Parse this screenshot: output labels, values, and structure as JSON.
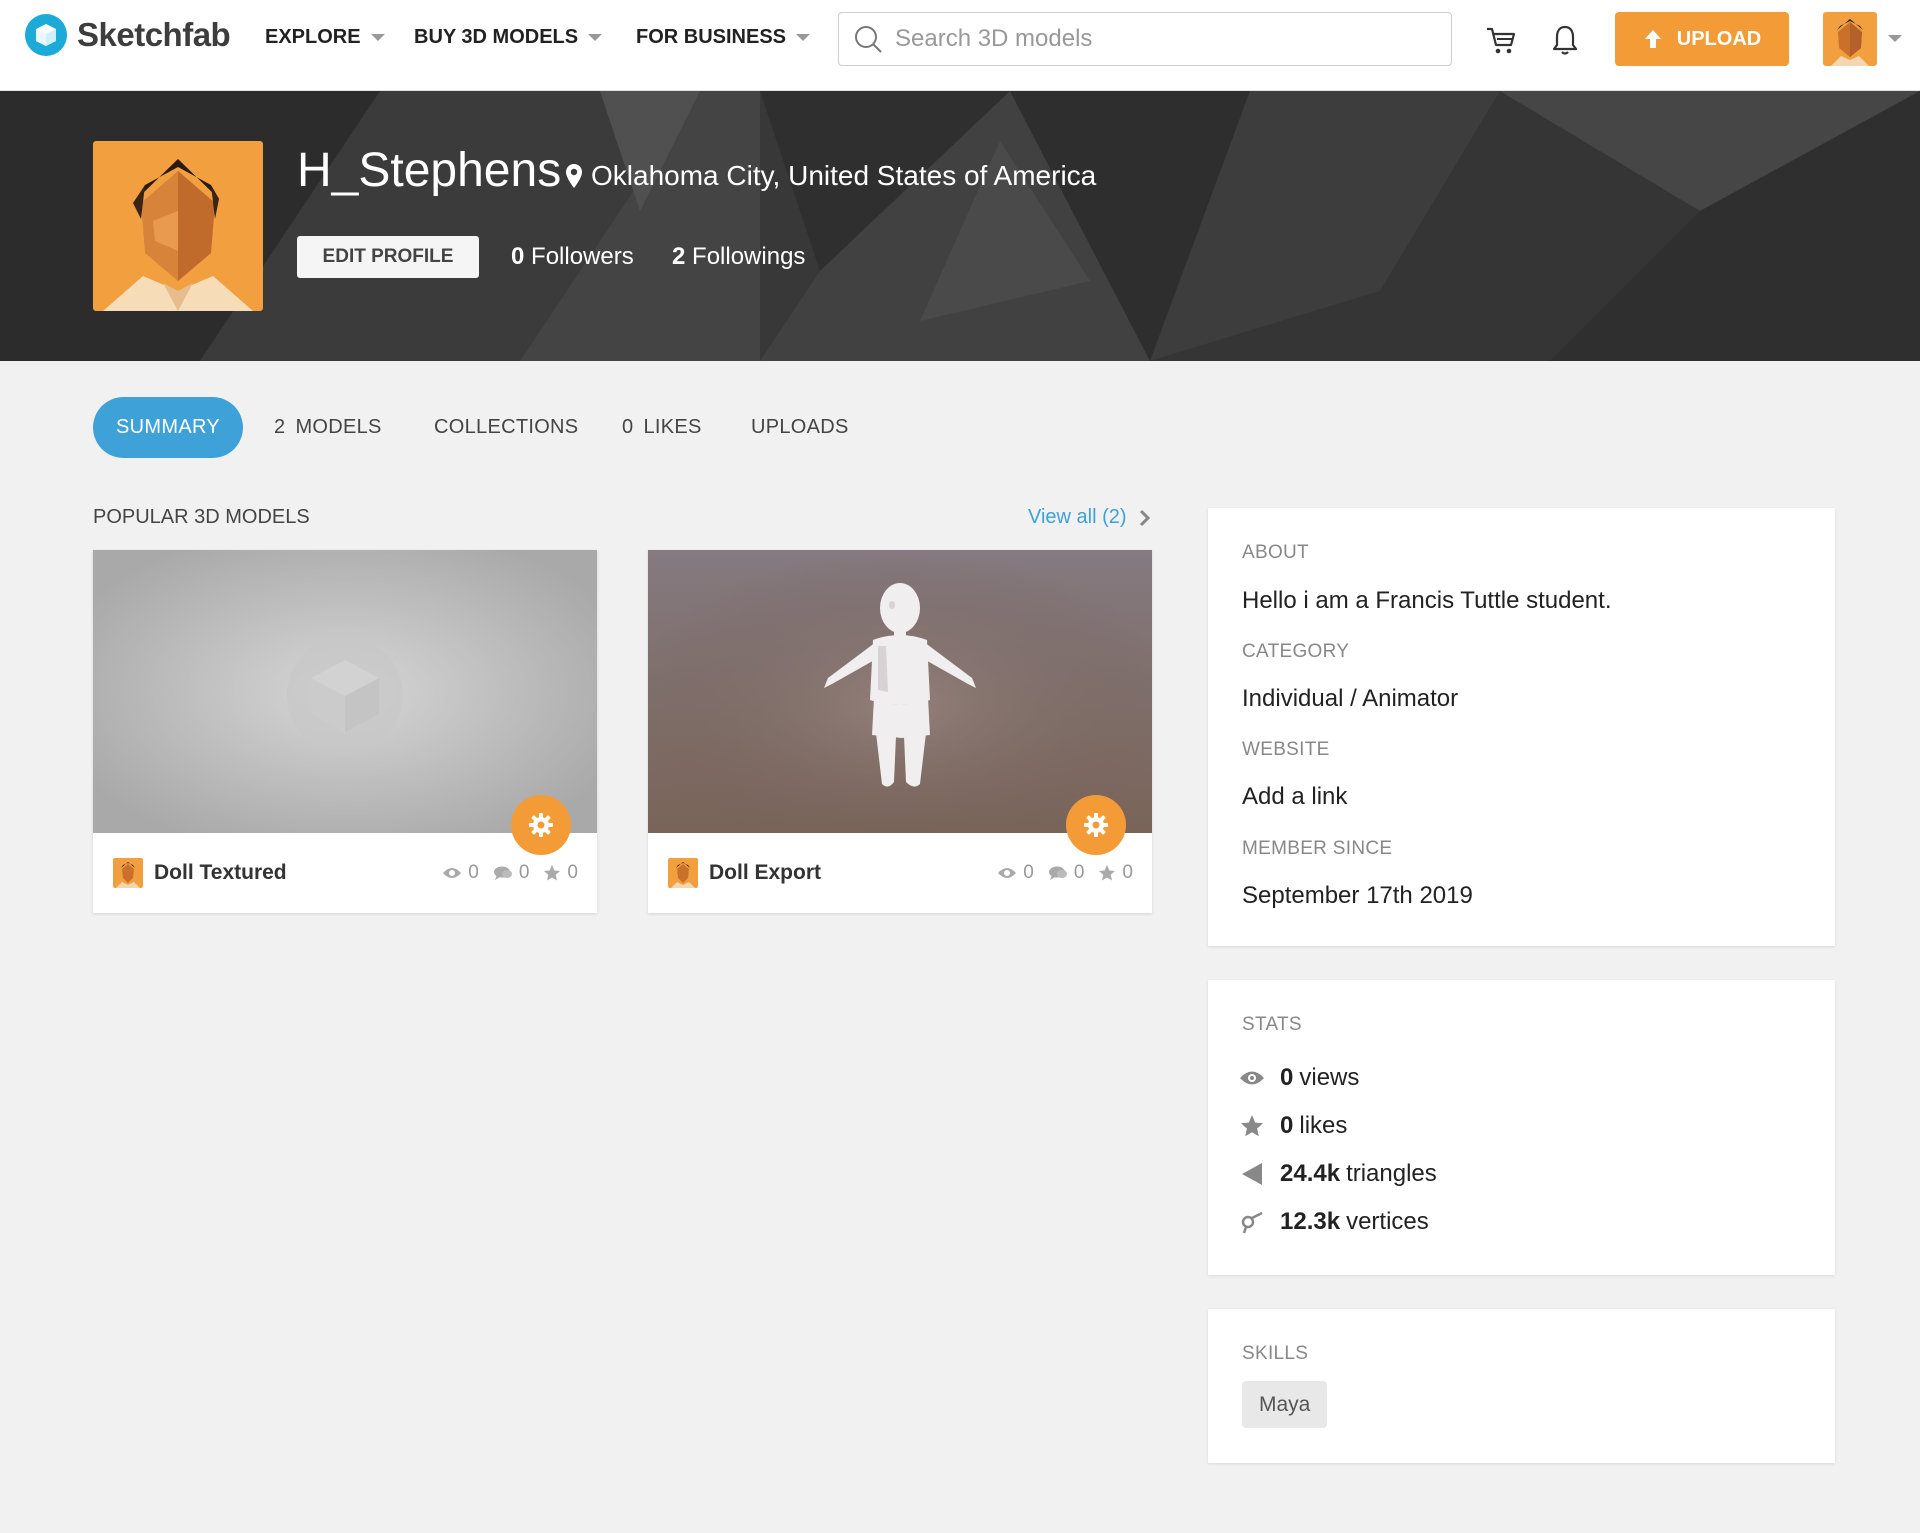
{
  "nav": {
    "logo_text": "Sketchfab",
    "explore": "EXPLORE",
    "buy": "BUY 3D MODELS",
    "business": "FOR BUSINESS",
    "search_placeholder": "Search 3D models",
    "upload": "UPLOAD"
  },
  "profile": {
    "username": "H_Stephens",
    "location": "Oklahoma City, United States of America",
    "edit_profile": "EDIT PROFILE",
    "followers_count": "0",
    "followers_label": "Followers",
    "followings_count": "2",
    "followings_label": "Followings"
  },
  "tabs": {
    "summary": "SUMMARY",
    "models_count": "2",
    "models": "MODELS",
    "collections": "COLLECTIONS",
    "likes_count": "0",
    "likes": "LIKES",
    "uploads": "UPLOADS"
  },
  "popular": {
    "title": "POPULAR 3D MODELS",
    "view_all": "View all (2)",
    "models": [
      {
        "title": "Doll Textured",
        "views": "0",
        "comments": "0",
        "likes": "0"
      },
      {
        "title": "Doll Export",
        "views": "0",
        "comments": "0",
        "likes": "0"
      }
    ]
  },
  "about": {
    "about_label": "ABOUT",
    "about_text": "Hello i am a Francis Tuttle student.",
    "category_label": "CATEGORY",
    "category": "Individual / Animator",
    "website_label": "WEBSITE",
    "website": "Add a link",
    "member_label": "MEMBER SINCE",
    "member_since": "September 17th 2019"
  },
  "stats": {
    "label": "STATS",
    "views_value": "0",
    "views_label": "views",
    "likes_value": "0",
    "likes_label": "likes",
    "triangles_value": "24.4k",
    "triangles_label": "triangles",
    "vertices_value": "12.3k",
    "vertices_label": "vertices"
  },
  "skills": {
    "label": "SKILLS",
    "items": [
      "Maya"
    ]
  },
  "colors": {
    "accent_blue": "#3ea1d8",
    "upload_orange": "#f39c37",
    "logo_blue": "#1caad9"
  }
}
